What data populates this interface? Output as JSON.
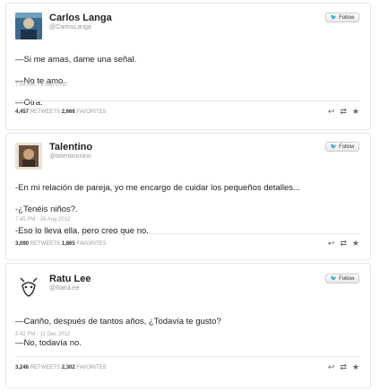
{
  "tweets": [
    {
      "name": "Carlos Langa",
      "handle": "@CarlosLanga",
      "follow_label": "Follow",
      "lines": [
        "—Si me amas, dame una señal.",
        "—No te amo.",
        "—Otra."
      ],
      "date": "7:04 AM - 3 Sep 2012",
      "retweets_count": "4,457",
      "retweets_label": "RETWEETS",
      "favorites_count": "2,666",
      "favorites_label": "FAVORITES",
      "avatar": "avatar-photo"
    },
    {
      "name": "Talentino",
      "handle": "@talentinonino",
      "follow_label": "Follow",
      "lines": [
        "-En mi relación de pareja, yo me encargo de cuidar los pequeños detalles...",
        "-¿Tenéis niños?.",
        "-Eso lo lleva ella, pero creo que no."
      ],
      "date": "7:45 PM - 26 Aug 2012",
      "retweets_count": "3,090",
      "retweets_label": "RETWEETS",
      "favorites_count": "1,865",
      "favorites_label": "FAVORITES",
      "avatar": "avatar-photo"
    },
    {
      "name": "Ratu Lee",
      "handle": "@RatuLee",
      "follow_label": "Follow",
      "lines": [
        "—Cariño, después de tantos años, ¿Todavía te gusto?",
        "—No, todavía no."
      ],
      "date": "2:42 PM - 11 Dec 2012",
      "retweets_count": "3,246",
      "retweets_label": "RETWEETS",
      "favorites_count": "2,302",
      "favorites_label": "FAVORITES",
      "avatar": "avatar-drawing"
    }
  ],
  "icons": {
    "follow_bird": "twitter-bird-icon",
    "reply": "reply-icon",
    "retweet": "retweet-icon",
    "favorite": "star-icon"
  },
  "colors": {
    "accent": "#55acee",
    "border": "#e1e8ed"
  }
}
